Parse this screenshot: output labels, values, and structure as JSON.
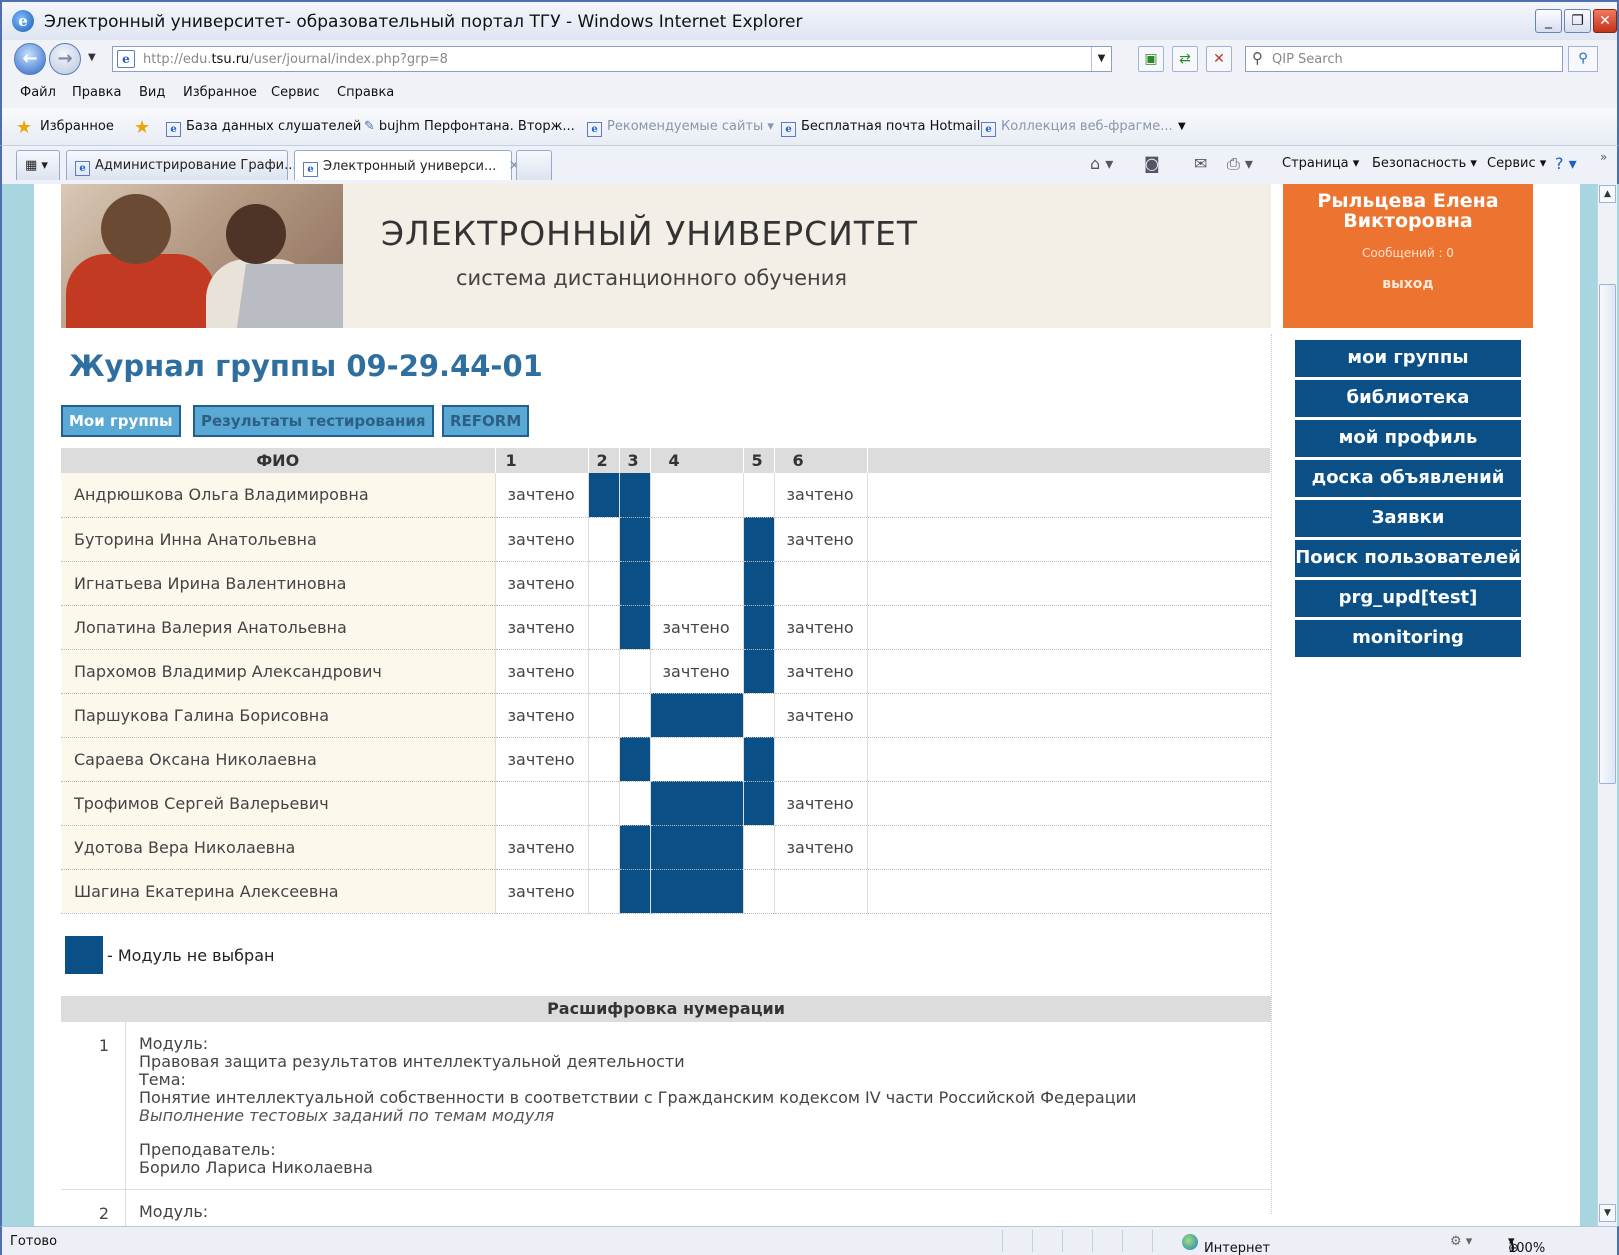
{
  "window": {
    "title": "Электронный университет- образовательный портал ТГУ - Windows Internet Explorer",
    "minimize": "_",
    "restore": "❐",
    "close": "✕"
  },
  "nav": {
    "url_prefix": "http://edu.",
    "url_domain": "tsu.ru",
    "url_path": "/user/journal/index.php?grp=8",
    "search_placeholder": "QIP Search"
  },
  "menu": [
    "Файл",
    "Правка",
    "Вид",
    "Избранное",
    "Сервис",
    "Справка"
  ],
  "favorites": {
    "label": "Избранное",
    "items": [
      {
        "label": "База данных слушателей",
        "dim": false
      },
      {
        "label": "bujhm Перфонтана. Вторж...",
        "dim": false
      },
      {
        "label": "Рекомендуемые сайты ▾",
        "dim": true
      },
      {
        "label": "Бесплатная почта Hotmail",
        "dim": false
      },
      {
        "label": "Коллекция веб-фрагме...",
        "dim": true
      }
    ]
  },
  "tabs": [
    {
      "label": "Администрирование Графи...",
      "active": false
    },
    {
      "label": "Электронный универси...",
      "active": true
    }
  ],
  "commands": {
    "page": "Страница ▾",
    "security": "Безопасность ▾",
    "service": "Сервис ▾"
  },
  "header": {
    "title": "ЭЛЕКТРОННЫЙ УНИВЕРСИТЕТ",
    "subtitle": "система дистанционного обучения",
    "user_name": "Рыльцева Елена Викторовна",
    "messages": "Сообщений : 0",
    "logout": "выход"
  },
  "sidebar": {
    "items": [
      {
        "label": "мои группы"
      },
      {
        "label": "библиотека"
      },
      {
        "label": "мой профиль"
      },
      {
        "label": "доска объявлений"
      },
      {
        "label": "Заявки"
      },
      {
        "label": "Поиск пользователей"
      },
      {
        "label": "prg_upd[test]"
      },
      {
        "label": "monitoring"
      }
    ]
  },
  "journal": {
    "title": "Журнал группы 09-29.44-01",
    "buttons": {
      "my_groups": "Мои группы",
      "test_results": "Результаты тестирования",
      "reform": "REFORM"
    },
    "columns": [
      "ФИО",
      "1",
      "2",
      "3",
      "4",
      "5",
      "6"
    ],
    "rows": [
      {
        "name": "Андрюшкова Ольга Владимировна",
        "cells": [
          "зачтено",
          "#",
          "#",
          "",
          "",
          "зачтено"
        ]
      },
      {
        "name": "Буторина Инна Анатольевна",
        "cells": [
          "зачтено",
          "",
          "#",
          "",
          "#",
          "зачтено"
        ]
      },
      {
        "name": "Игнатьева Ирина Валентиновна",
        "cells": [
          "зачтено",
          "",
          "#",
          "",
          "#",
          ""
        ]
      },
      {
        "name": "Лопатина Валерия Анатольевна",
        "cells": [
          "зачтено",
          "",
          "#",
          "зачтено",
          "#",
          "зачтено"
        ]
      },
      {
        "name": "Пархомов Владимир Александрович",
        "cells": [
          "зачтено",
          "",
          "",
          "зачтено",
          "#",
          "зачтено"
        ]
      },
      {
        "name": "Паршукова Галина Борисовна",
        "cells": [
          "зачтено",
          "",
          "",
          "#",
          "",
          "зачтено"
        ]
      },
      {
        "name": "Сараева Оксана Николаевна",
        "cells": [
          "зачтено",
          "",
          "#",
          "",
          "#",
          ""
        ]
      },
      {
        "name": "Трофимов Сергей Валерьевич",
        "cells": [
          "",
          "",
          "",
          "#",
          "#",
          "зачтено"
        ]
      },
      {
        "name": "Удотова Вера Николаевна",
        "cells": [
          "зачтено",
          "",
          "#",
          "#",
          "",
          "зачтено"
        ]
      },
      {
        "name": "Шагина Екатерина Алексеевна",
        "cells": [
          "зачтено",
          "",
          "#",
          "#",
          "",
          ""
        ]
      }
    ],
    "legend": "- Модуль не выбран",
    "not_selected_color": "#0a4f86"
  },
  "decoding": {
    "title": "Расшифровка нумерации",
    "entries": [
      {
        "num": "1",
        "module_label": "Модуль:",
        "module": "Правовая защита результатов интеллектуальной деятельности",
        "topic_label": "Тема:",
        "topic": "Понятие интеллектуальной собственности в соответствии с Гражданским кодексом IV части Российской Федерации",
        "task": "Выполнение тестовых заданий по темам модуля",
        "teacher_label": "Преподаватель:",
        "teacher": "Борило Лариса Николаевна"
      },
      {
        "num": "2",
        "module_label": "Модуль:"
      }
    ]
  },
  "status": {
    "ready": "Готово",
    "zone": "Интернет",
    "zoom": "100%"
  },
  "colors": {
    "accent": "#0a4f86",
    "user_box": "#ec7430",
    "title": "#2f6fa0"
  }
}
